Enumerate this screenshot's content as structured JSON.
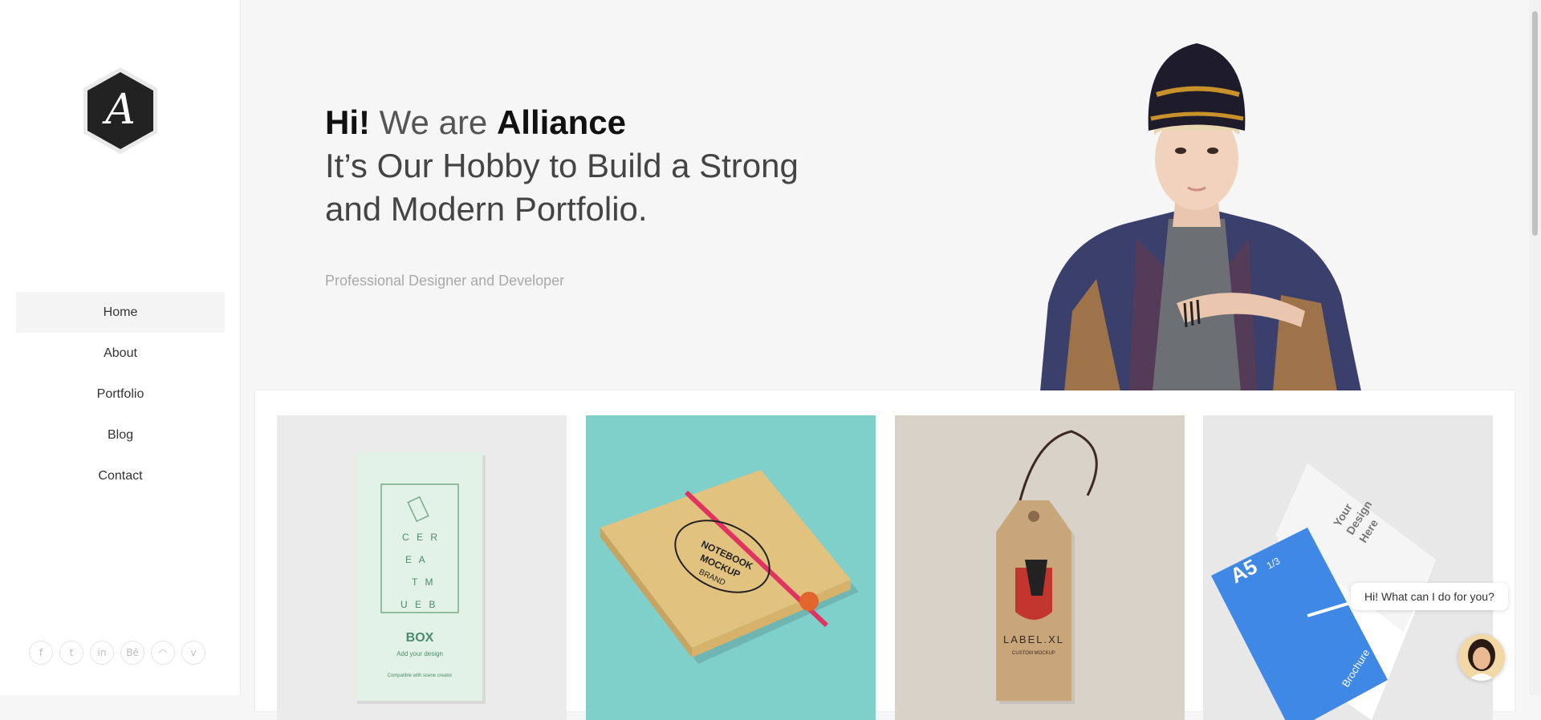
{
  "brand": {
    "logo_letter": "A"
  },
  "nav": {
    "items": [
      {
        "label": "Home"
      },
      {
        "label": "About"
      },
      {
        "label": "Portfolio"
      },
      {
        "label": "Blog"
      },
      {
        "label": "Contact"
      }
    ],
    "active": "Home"
  },
  "social": {
    "icons": [
      {
        "name": "facebook-icon",
        "glyph": "f"
      },
      {
        "name": "twitter-icon",
        "glyph": "t"
      },
      {
        "name": "linkedin-icon",
        "glyph": "in"
      },
      {
        "name": "behance-icon",
        "glyph": "Bē"
      },
      {
        "name": "rss-icon",
        "glyph": "◠"
      },
      {
        "name": "vimeo-icon",
        "glyph": "v"
      }
    ]
  },
  "hero": {
    "hi": "Hi!",
    "we_are": " We are ",
    "name": "Alliance",
    "line2": "It’s Our Hobby to Build a Strong",
    "line3": "and Modern Portfolio.",
    "subtitle": "Professional Designer and Developer"
  },
  "portfolio": {
    "tiles": [
      {
        "name": "cereal-box-mockup",
        "texts": [
          "C E R",
          "E A",
          "T M",
          "U E B",
          "BOX",
          "Add your design",
          "Compatible with scene creator"
        ]
      },
      {
        "name": "notebook-mockup",
        "texts": [
          "NOTEBOOK",
          "MOCKUP",
          "BRAND"
        ]
      },
      {
        "name": "label-tag-mockup",
        "texts": [
          "LABEL.XL",
          "CUSTOM MOCKUP"
        ]
      },
      {
        "name": "brochure-mockup",
        "texts": [
          "A5",
          "1/3",
          "Your",
          "Design",
          "Here",
          "Brochure"
        ]
      }
    ]
  },
  "chat": {
    "message": "Hi! What can I do for you?"
  },
  "colors": {
    "teal": "#7fcfcb",
    "blue": "#3f88e6",
    "dark": "#1a1a1a"
  }
}
